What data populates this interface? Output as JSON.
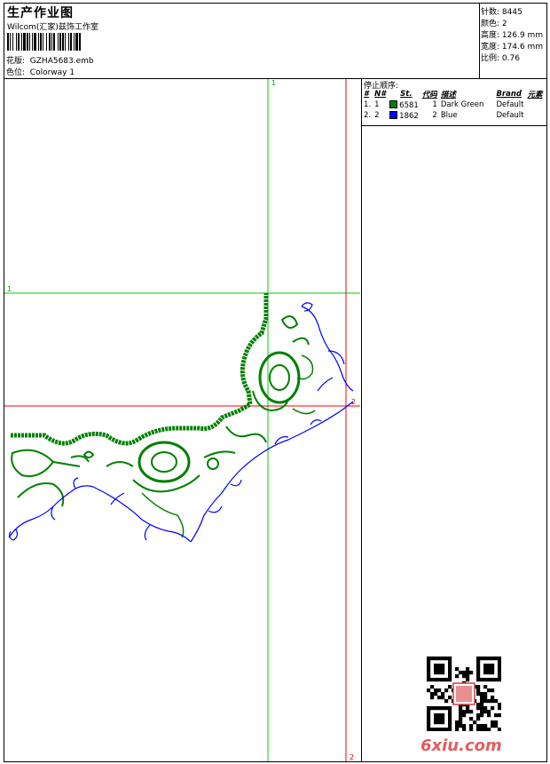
{
  "header": {
    "title": "生产作业图",
    "company": "Wilcom(汇家)兹饰工作室",
    "design_label": "花版:",
    "design_value": "GZHA5683.emb",
    "colorway_label": "色位:",
    "colorway_value": "Colorway 1"
  },
  "stats": [
    {
      "label": "针数:",
      "value": "8445"
    },
    {
      "label": "颜色:",
      "value": "2"
    },
    {
      "label": "高度:",
      "value": "126.9 mm"
    },
    {
      "label": "宽度:",
      "value": "174.6 mm"
    },
    {
      "label": "比例:",
      "value": "0.76"
    }
  ],
  "stop_sequence": {
    "title": "停止顺序:",
    "headers": [
      "#",
      "N#",
      "St.",
      "代码",
      "描述",
      "Brand",
      "元素"
    ],
    "rows": [
      {
        "idx": "1.",
        "n": "1",
        "color": "#008000",
        "st": "6581",
        "code": "1",
        "desc": "Dark Green",
        "brand": "Default"
      },
      {
        "idx": "2.",
        "n": "2",
        "color": "#0000ff",
        "st": "1862",
        "code": "2",
        "desc": "Blue",
        "brand": "Default"
      }
    ]
  },
  "markers": {
    "green_top": "1",
    "green_left": "1",
    "red_bottom": "2",
    "red_right": "2"
  },
  "colors": {
    "green": "#008000",
    "blue": "#0000ff",
    "guide_green": "#00cc00",
    "guide_red": "#ff0000"
  },
  "watermark": "6xiu.com"
}
